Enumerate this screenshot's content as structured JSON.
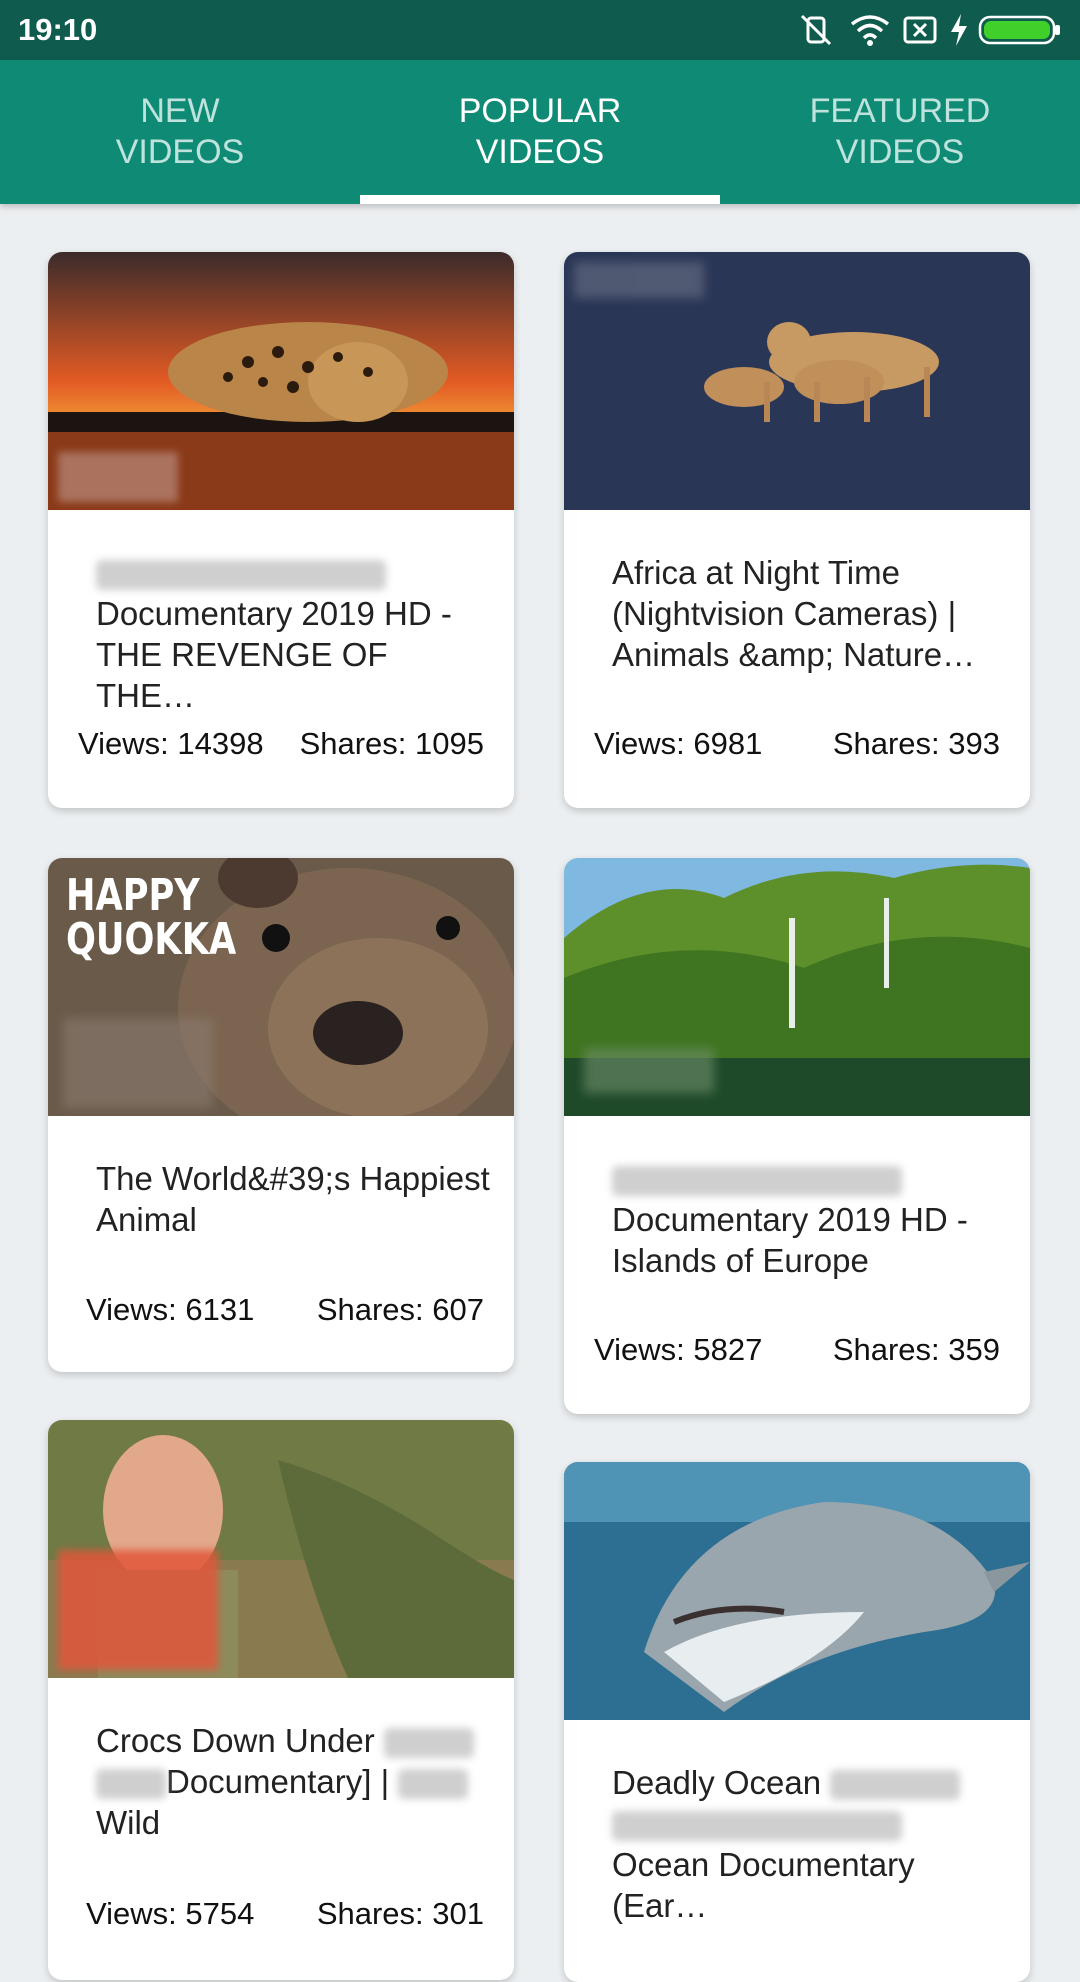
{
  "status": {
    "time": "19:10",
    "icons": [
      "vibrate-off-icon",
      "wifi-icon",
      "no-sim-icon",
      "charging-icon",
      "battery-icon"
    ]
  },
  "tabs": [
    {
      "label": "NEW\nVIDEOS"
    },
    {
      "label": "POPULAR\nVIDEOS"
    },
    {
      "label": "FEATURED\nVIDEOS"
    }
  ],
  "active_tab": 1,
  "videos": [
    {
      "title_part": "Documentary 2019 HD -",
      "title_part2": "THE REVENGE OF THE…",
      "views": "Views: 14398",
      "shares": "Shares: 1095"
    },
    {
      "title": "Africa at Night Time",
      "title2": "(Nightvision Cameras) |",
      "title3": "Animals &amp; Nature…",
      "views": "Views: 6981",
      "shares": "Shares: 393"
    },
    {
      "title": "The World&#39;s Happiest",
      "title2": "Animal",
      "thumb_text": "HAPPY QUOKKA",
      "views": "Views: 6131",
      "shares": "Shares: 607"
    },
    {
      "title_part": "Documentary 2019 HD -",
      "title_part2": "Islands of Europe",
      "views": "Views: 5827",
      "shares": "Shares: 359"
    },
    {
      "title": "Crocs Down Under",
      "title2": "Documentary] |",
      "title3": "Wild",
      "views": "Views: 5754",
      "shares": "Shares: 301"
    },
    {
      "title": "Deadly Ocean",
      "title3": "Ocean Documentary (Ear…"
    }
  ]
}
